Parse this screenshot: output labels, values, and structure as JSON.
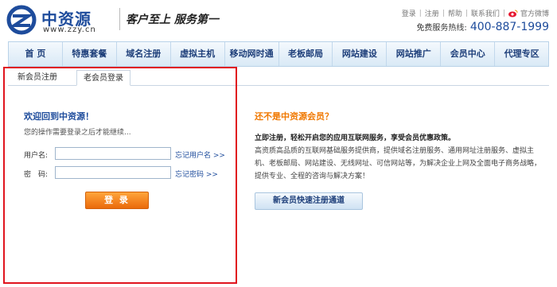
{
  "header": {
    "brand_name": "中资源",
    "brand_url": "www.zzy.cn",
    "slogan": "客户至上 服务第一",
    "top_links": [
      "登录",
      "注册",
      "帮助",
      "联系我们"
    ],
    "weibo_label": "官方微博",
    "hotline_label": "免费服务热线:",
    "hotline_number": "400-887-1999"
  },
  "nav": {
    "items": [
      "首 页",
      "特惠套餐",
      "域名注册",
      "虚拟主机",
      "移动网时通",
      "老板邮局",
      "网站建设",
      "网站推广",
      "会员中心",
      "代理专区"
    ]
  },
  "tabs": {
    "new_member": "新会员注册",
    "old_member": "老会员登录"
  },
  "login": {
    "welcome": "欢迎回到中资源！",
    "hint": "您的操作需要登录之后才能继续...",
    "username_label": "用户名:",
    "password_label": "密　码:",
    "username_value": "",
    "password_value": "",
    "forgot_username": "忘记用户名 >>",
    "forgot_password": "忘记密码 >>",
    "submit": "登 录"
  },
  "promo": {
    "title": "还不是中资源会员？",
    "strong": "立即注册，轻松开启您的应用互联网服务，享受会员优惠政策。",
    "description": "高资质高品质的互联网基础服务提供商，提供域名注册服务、通用网址注册服务、虚拟主机、老板邮局、网站建设、无线网址、可信网站等，为解决企业上网及全面电子商务战略，提供专业、全程的咨询与解决方案！",
    "register_button": "新会员快速注册通道"
  },
  "colors": {
    "brand_blue": "#1e4c9c",
    "accent_orange": "#f07800",
    "highlight_red": "#e0141e"
  }
}
